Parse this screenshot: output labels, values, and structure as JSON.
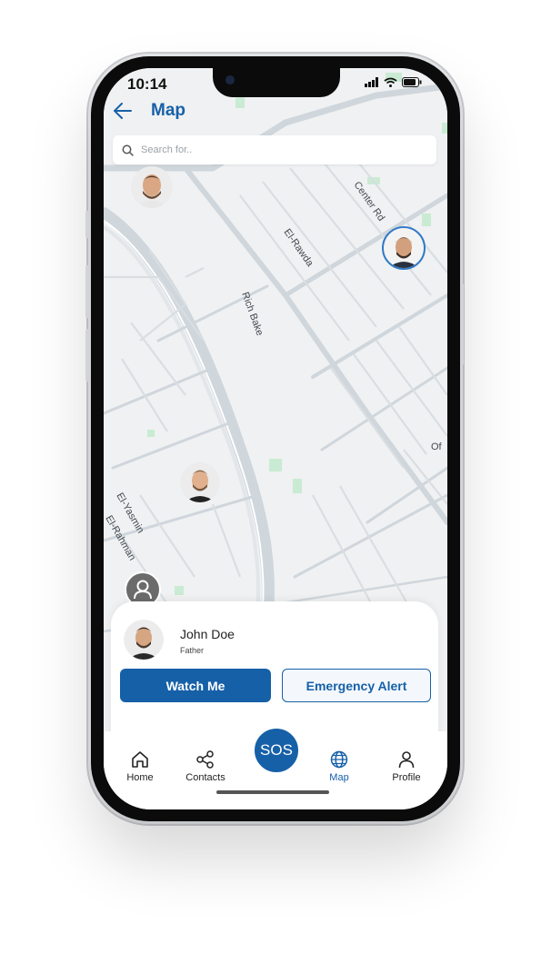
{
  "status_bar": {
    "time": "10:14"
  },
  "header": {
    "title": "Map"
  },
  "search": {
    "placeholder": "Search for.."
  },
  "map": {
    "street_labels": [
      "Center Rd",
      "El-Rawda",
      "Rich Bake",
      "El-Yasmin",
      "El-Rahman",
      "Of"
    ]
  },
  "contact": {
    "name": "John Doe",
    "role": "Father"
  },
  "actions": {
    "watch_label": "Watch Me",
    "alert_label": "Emergency Alert"
  },
  "tabs": [
    {
      "label": "Home",
      "icon": "home-icon"
    },
    {
      "label": "Contacts",
      "icon": "share-icon"
    },
    {
      "label": "SOS",
      "icon": "sos-button"
    },
    {
      "label": "Map",
      "icon": "globe-icon",
      "active": true
    },
    {
      "label": "Profile",
      "icon": "user-icon"
    }
  ],
  "colors": {
    "accent": "#1660a8",
    "map_bg": "#f0f1f2",
    "road": "#cfd6dc",
    "park": "#c9ebd3"
  }
}
